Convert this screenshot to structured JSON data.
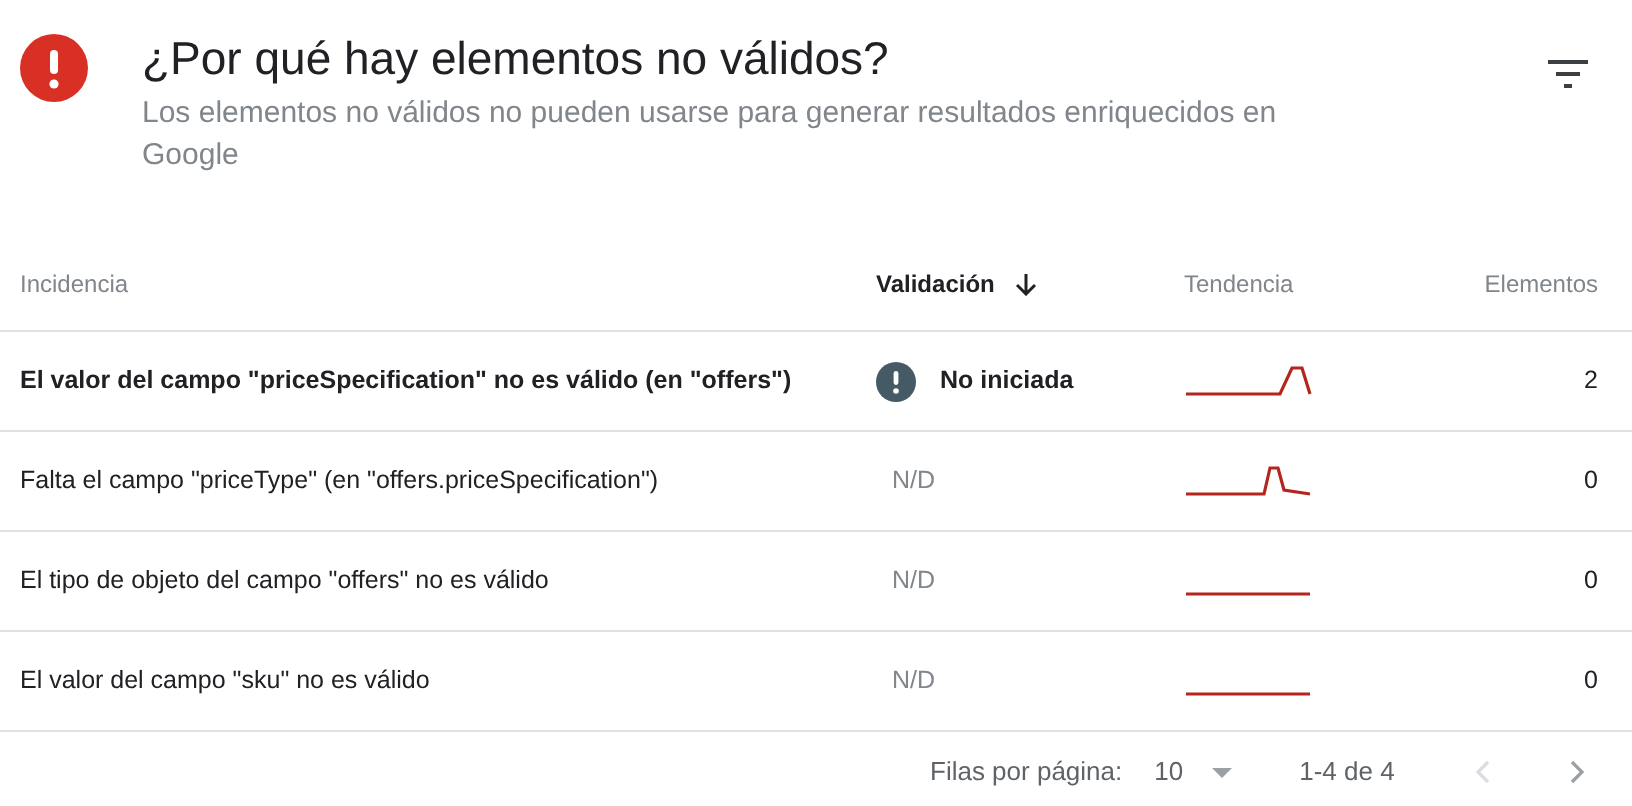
{
  "header": {
    "title": "¿Por qué hay elementos no válidos?",
    "subtitle": "Los elementos no válidos no pueden usarse para generar resultados enriquecidos en Google"
  },
  "table": {
    "columns": [
      {
        "label": "Incidencia",
        "sorted": false
      },
      {
        "label": "Validación",
        "sorted": true
      },
      {
        "label": "Tendencia",
        "sorted": false
      },
      {
        "label": "Elementos",
        "sorted": false
      }
    ],
    "rows": [
      {
        "issue": "El valor del campo \"priceSpecification\" no es válido (en \"offers\")",
        "highlighted": true,
        "validation": {
          "kind": "status",
          "text": "No iniciada"
        },
        "kind": "late-spike",
        "count": "2"
      },
      {
        "issue": "Falta el campo \"priceType\" (en \"offers.priceSpecification\")",
        "highlighted": false,
        "validation": {
          "kind": "na",
          "text": "N/D"
        },
        "kind": "spike",
        "count": "0"
      },
      {
        "issue": "El tipo de objeto del campo \"offers\" no es válido",
        "highlighted": false,
        "validation": {
          "kind": "na",
          "text": "N/D"
        },
        "kind": "flat",
        "count": "0"
      },
      {
        "issue": "El valor del campo \"sku\" no es válido",
        "highlighted": false,
        "validation": {
          "kind": "na",
          "text": "N/D"
        },
        "kind": "flat",
        "count": "0"
      }
    ]
  },
  "pagination": {
    "rows_label": "Filas por página:",
    "rows_value": "10",
    "range": "1-4 de 4",
    "prev_disabled": true,
    "next_disabled": false
  }
}
